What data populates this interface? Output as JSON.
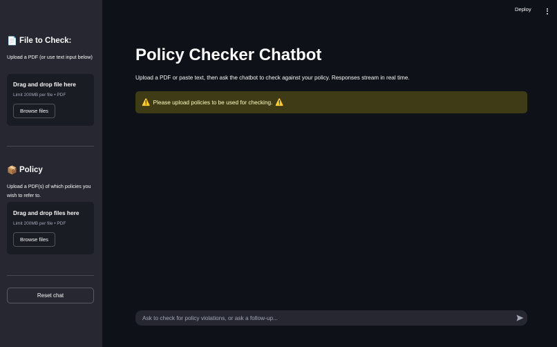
{
  "sidebar": {
    "file_section": {
      "icon": "📄",
      "icon_name": "document-icon",
      "heading": "File to Check:",
      "description": "Upload a PDF (or use text input below)",
      "uploader": {
        "title": "Drag and drop file here",
        "limit": "Limit 200MB per file • PDF",
        "browse_label": "Browse files"
      }
    },
    "policy_section": {
      "icon": "📦",
      "icon_name": "box-icon",
      "heading": "Policy",
      "description": "Upload a PDF(s) of which policies you wish to refer to.",
      "uploader": {
        "title": "Drag and drop files here",
        "limit": "Limit 200MB per file • PDF",
        "browse_label": "Browse files"
      }
    },
    "reset_label": "Reset chat"
  },
  "header": {
    "deploy_label": "Deploy",
    "menu_icon": "kebab-menu-icon"
  },
  "main": {
    "title": "Policy Checker Chatbot",
    "intro": "Upload a PDF or paste text, then ask the chatbot to check against your policy. Responses stream in real time.",
    "warning": {
      "icon": "⚠️",
      "text": "Please upload policies to be used for checking."
    }
  },
  "chat": {
    "placeholder": "Ask to check for policy violations, or ask a follow-up...",
    "send_icon": "send-icon"
  },
  "colors": {
    "background": "#0e1117",
    "sidebar": "#262730",
    "warning_bg": "#3e3b16",
    "warning_text": "#ffffc2"
  }
}
